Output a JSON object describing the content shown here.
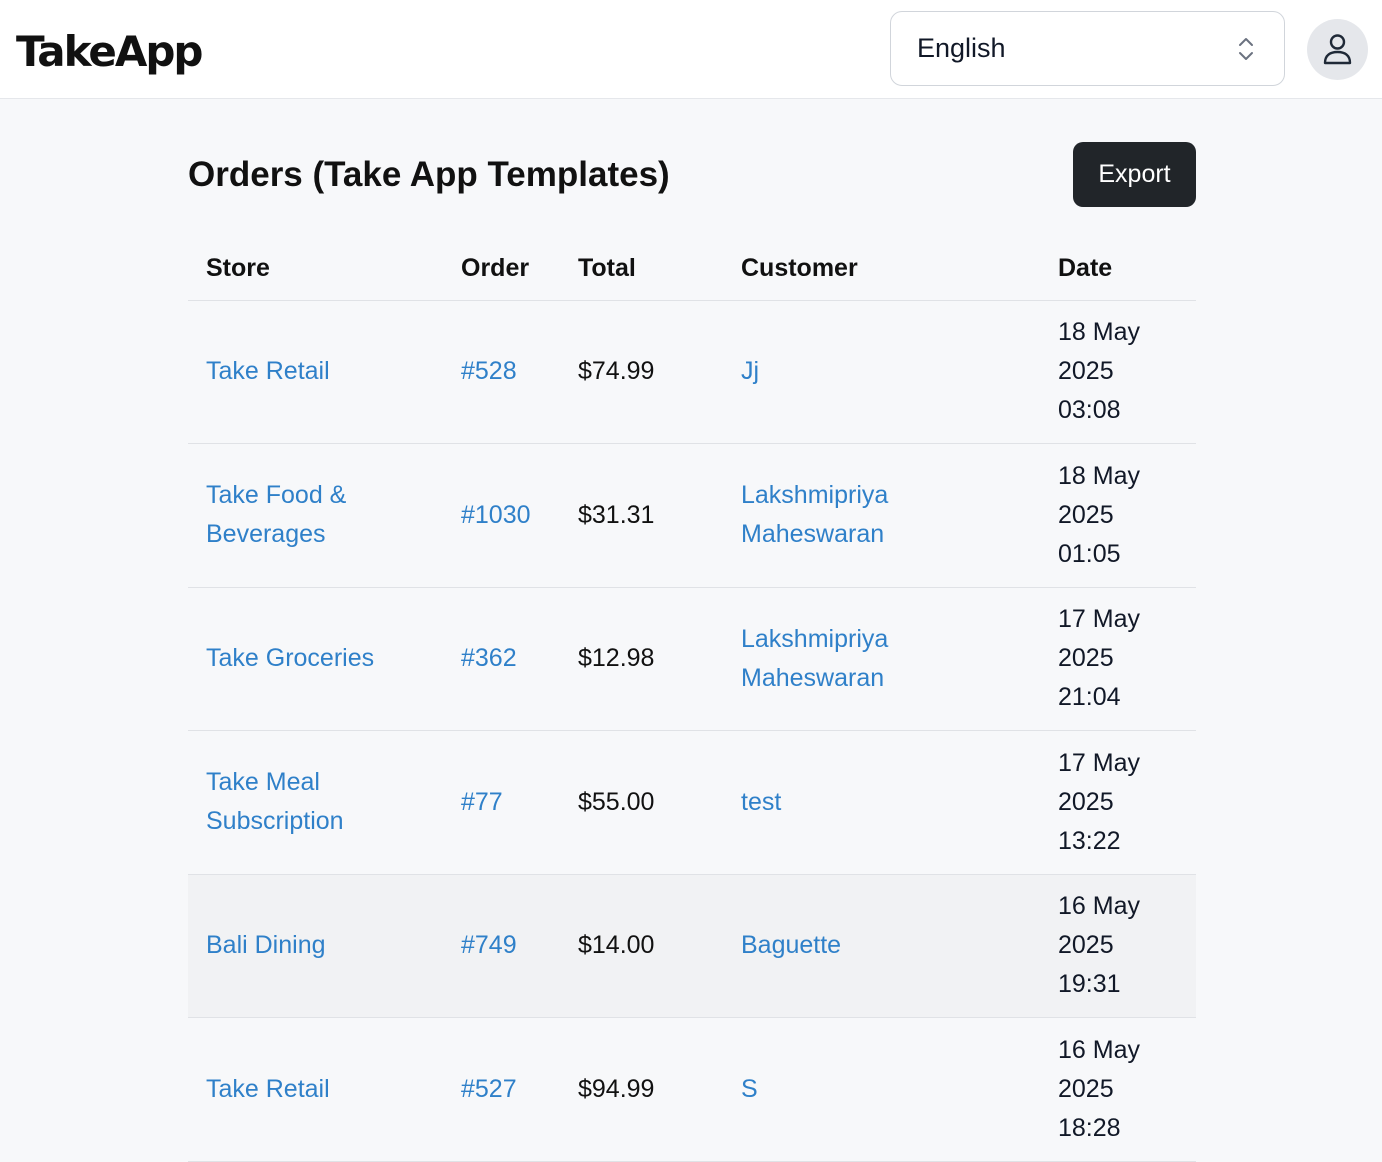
{
  "header": {
    "logo": "TakeApp",
    "language": {
      "selected": "English"
    },
    "user_menu_icon": "user-icon"
  },
  "page": {
    "title": "Orders (Take App Templates)",
    "export_label": "Export"
  },
  "table": {
    "columns": [
      "Store",
      "Order",
      "Total",
      "Customer",
      "Date"
    ],
    "rows": [
      {
        "store": "Take Retail",
        "order": "#528",
        "total": "$74.99",
        "customer": "Jj",
        "date": [
          "18 May",
          "2025",
          "03:08"
        ]
      },
      {
        "store": "Take Food & Beverages",
        "order": "#1030",
        "total": "$31.31",
        "customer": "Lakshmipriya Maheswaran",
        "date": [
          "18 May",
          "2025",
          "01:05"
        ]
      },
      {
        "store": "Take Groceries",
        "order": "#362",
        "total": "$12.98",
        "customer": "Lakshmipriya Maheswaran",
        "date": [
          "17 May",
          "2025",
          "21:04"
        ]
      },
      {
        "store": "Take Meal Subscription",
        "order": "#77",
        "total": "$55.00",
        "customer": "test",
        "date": [
          "17 May",
          "2025",
          "13:22"
        ]
      },
      {
        "store": "Bali Dining",
        "order": "#749",
        "total": "$14.00",
        "customer": "Baguette",
        "date": [
          "16 May",
          "2025",
          "19:31"
        ]
      },
      {
        "store": "Take Retail",
        "order": "#527",
        "total": "$94.99",
        "customer": "S",
        "date": [
          "16 May",
          "2025",
          "18:28"
        ]
      }
    ]
  },
  "colors": {
    "link": "#2f80c9",
    "export_bg": "#212529",
    "page_bg": "#f7f8fa"
  }
}
